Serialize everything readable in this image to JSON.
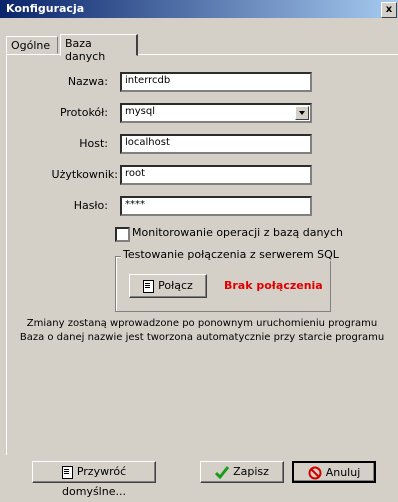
{
  "window": {
    "title": "Konfiguracja",
    "close_glyph": "x"
  },
  "tabs": [
    {
      "label": "Ogólne"
    },
    {
      "label": "Baza danych"
    }
  ],
  "form": {
    "name_label": "Nazwa:",
    "name_value": "interrcdb",
    "protocol_label": "Protokół:",
    "protocol_value": "mysql",
    "host_label": "Host:",
    "host_value": "localhost",
    "user_label": "Użytkownik:",
    "user_value": "root",
    "password_label": "Hasło:",
    "password_value": "****",
    "monitor_label": "Monitorowanie operacji z bazą danych",
    "monitor_checked": false
  },
  "test_group": {
    "title": "Testowanie połączenia z serwerem SQL",
    "connect_label": "Połącz",
    "status_text": "Brak połączenia",
    "status_color": "#e00000"
  },
  "info": {
    "line1": "Zmiany zostaną wprowadzone po ponownym uruchomieniu programu",
    "line2": "Baza o danej nazwie jest tworzona automatycznie przy starcie programu"
  },
  "buttons": {
    "restore_label": "Przywróć domyślne...",
    "save_label": "Zapisz",
    "cancel_label": "Anuluj"
  }
}
